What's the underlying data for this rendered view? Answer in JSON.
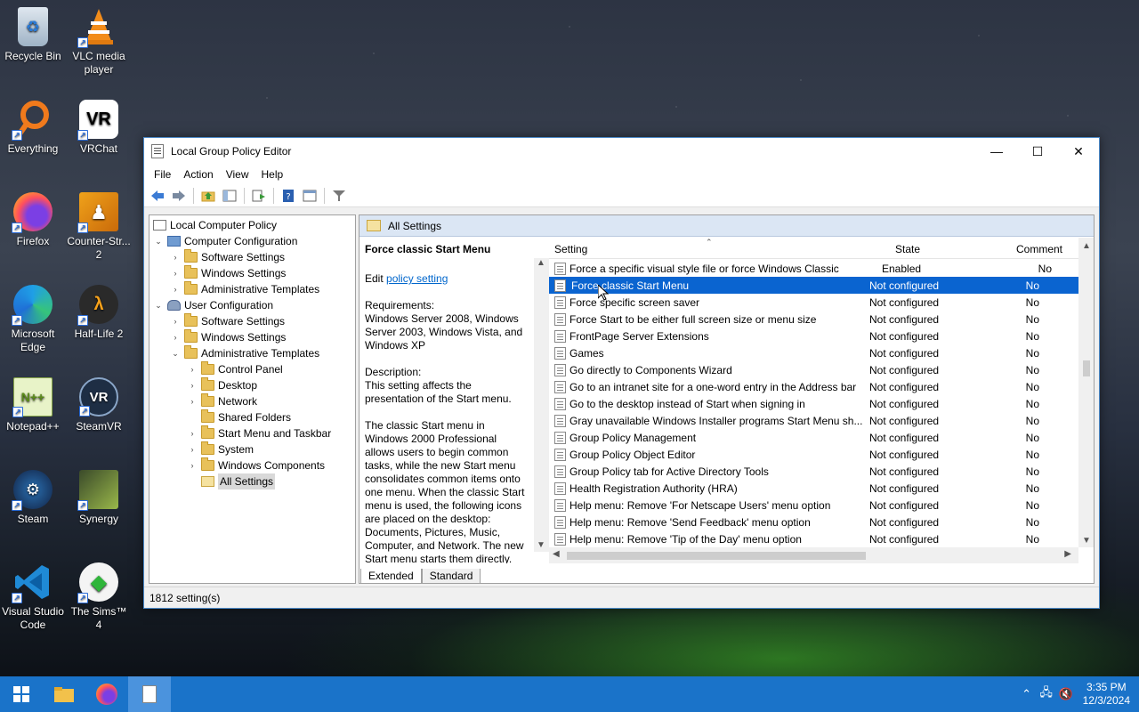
{
  "desktop": {
    "icons": [
      {
        "label": "Recycle Bin"
      },
      {
        "label": "VLC media player"
      },
      {
        "label": "Everything"
      },
      {
        "label": "VRChat"
      },
      {
        "label": "Firefox"
      },
      {
        "label": "Counter-Str... 2"
      },
      {
        "label": "Microsoft Edge"
      },
      {
        "label": "Half-Life 2"
      },
      {
        "label": "Notepad++"
      },
      {
        "label": "SteamVR"
      },
      {
        "label": "Steam"
      },
      {
        "label": "Synergy"
      },
      {
        "label": "Visual Studio Code"
      },
      {
        "label": "The Sims™ 4"
      }
    ]
  },
  "window": {
    "title": "Local Group Policy Editor",
    "controls": {
      "minimize": "—",
      "maximize": "☐",
      "close": "✕"
    },
    "menu": [
      "File",
      "Action",
      "View",
      "Help"
    ]
  },
  "tree": {
    "items": [
      {
        "label": "Local Computer Policy"
      },
      {
        "label": "Computer Configuration"
      },
      {
        "label": "Software Settings"
      },
      {
        "label": "Windows Settings"
      },
      {
        "label": "Administrative Templates"
      },
      {
        "label": "User Configuration"
      },
      {
        "label": "Software Settings"
      },
      {
        "label": "Windows Settings"
      },
      {
        "label": "Administrative Templates"
      },
      {
        "label": "Control Panel"
      },
      {
        "label": "Desktop"
      },
      {
        "label": "Network"
      },
      {
        "label": "Shared Folders"
      },
      {
        "label": "Start Menu and Taskbar"
      },
      {
        "label": "System"
      },
      {
        "label": "Windows Components"
      },
      {
        "label": "All Settings"
      }
    ]
  },
  "pane": {
    "header": "All Settings",
    "description": {
      "title": "Force classic Start Menu",
      "edit_prefix": "Edit ",
      "edit_link": "policy setting",
      "requirements": "Requirements:\nWindows Server 2008, Windows Server 2003, Windows Vista, and Windows XP",
      "desc_label": "Description:",
      "desc_text": "This setting affects the presentation of the Start menu.",
      "desc_more": "The classic Start menu in Windows 2000 Professional allows users to begin common tasks, while the new Start menu consolidates common items onto one menu. When the classic Start menu is used, the following icons are placed on the desktop: Documents, Pictures, Music, Computer, and Network. The new Start menu starts them directly."
    },
    "columns": {
      "setting": "Setting",
      "state": "State",
      "comment": "Comment"
    },
    "rows": [
      {
        "setting": "Force a specific visual style file or force Windows Classic",
        "state": "Enabled",
        "comment": "No"
      },
      {
        "setting": "Force classic Start Menu",
        "state": "Not configured",
        "comment": "No"
      },
      {
        "setting": "Force specific screen saver",
        "state": "Not configured",
        "comment": "No"
      },
      {
        "setting": "Force Start to be either full screen size or menu size",
        "state": "Not configured",
        "comment": "No"
      },
      {
        "setting": "FrontPage Server Extensions",
        "state": "Not configured",
        "comment": "No"
      },
      {
        "setting": "Games",
        "state": "Not configured",
        "comment": "No"
      },
      {
        "setting": "Go directly to Components Wizard",
        "state": "Not configured",
        "comment": "No"
      },
      {
        "setting": "Go to an intranet site for a one-word entry in the Address bar",
        "state": "Not configured",
        "comment": "No"
      },
      {
        "setting": "Go to the desktop instead of Start when signing in",
        "state": "Not configured",
        "comment": "No"
      },
      {
        "setting": "Gray unavailable Windows Installer programs Start Menu sh...",
        "state": "Not configured",
        "comment": "No"
      },
      {
        "setting": "Group Policy Management",
        "state": "Not configured",
        "comment": "No"
      },
      {
        "setting": "Group Policy Object Editor",
        "state": "Not configured",
        "comment": "No"
      },
      {
        "setting": "Group Policy tab for Active Directory Tools",
        "state": "Not configured",
        "comment": "No"
      },
      {
        "setting": "Health Registration Authority (HRA)",
        "state": "Not configured",
        "comment": "No"
      },
      {
        "setting": "Help menu: Remove 'For Netscape Users' menu option",
        "state": "Not configured",
        "comment": "No"
      },
      {
        "setting": "Help menu: Remove 'Send Feedback' menu option",
        "state": "Not configured",
        "comment": "No"
      },
      {
        "setting": "Help menu: Remove 'Tip of the Day' menu option",
        "state": "Not configured",
        "comment": "No"
      }
    ],
    "tabs": [
      "Extended",
      "Standard"
    ]
  },
  "status": {
    "count": "1812 setting(s)"
  },
  "taskbar": {
    "clock_time": "3:35 PM",
    "clock_date": "12/3/2024"
  }
}
